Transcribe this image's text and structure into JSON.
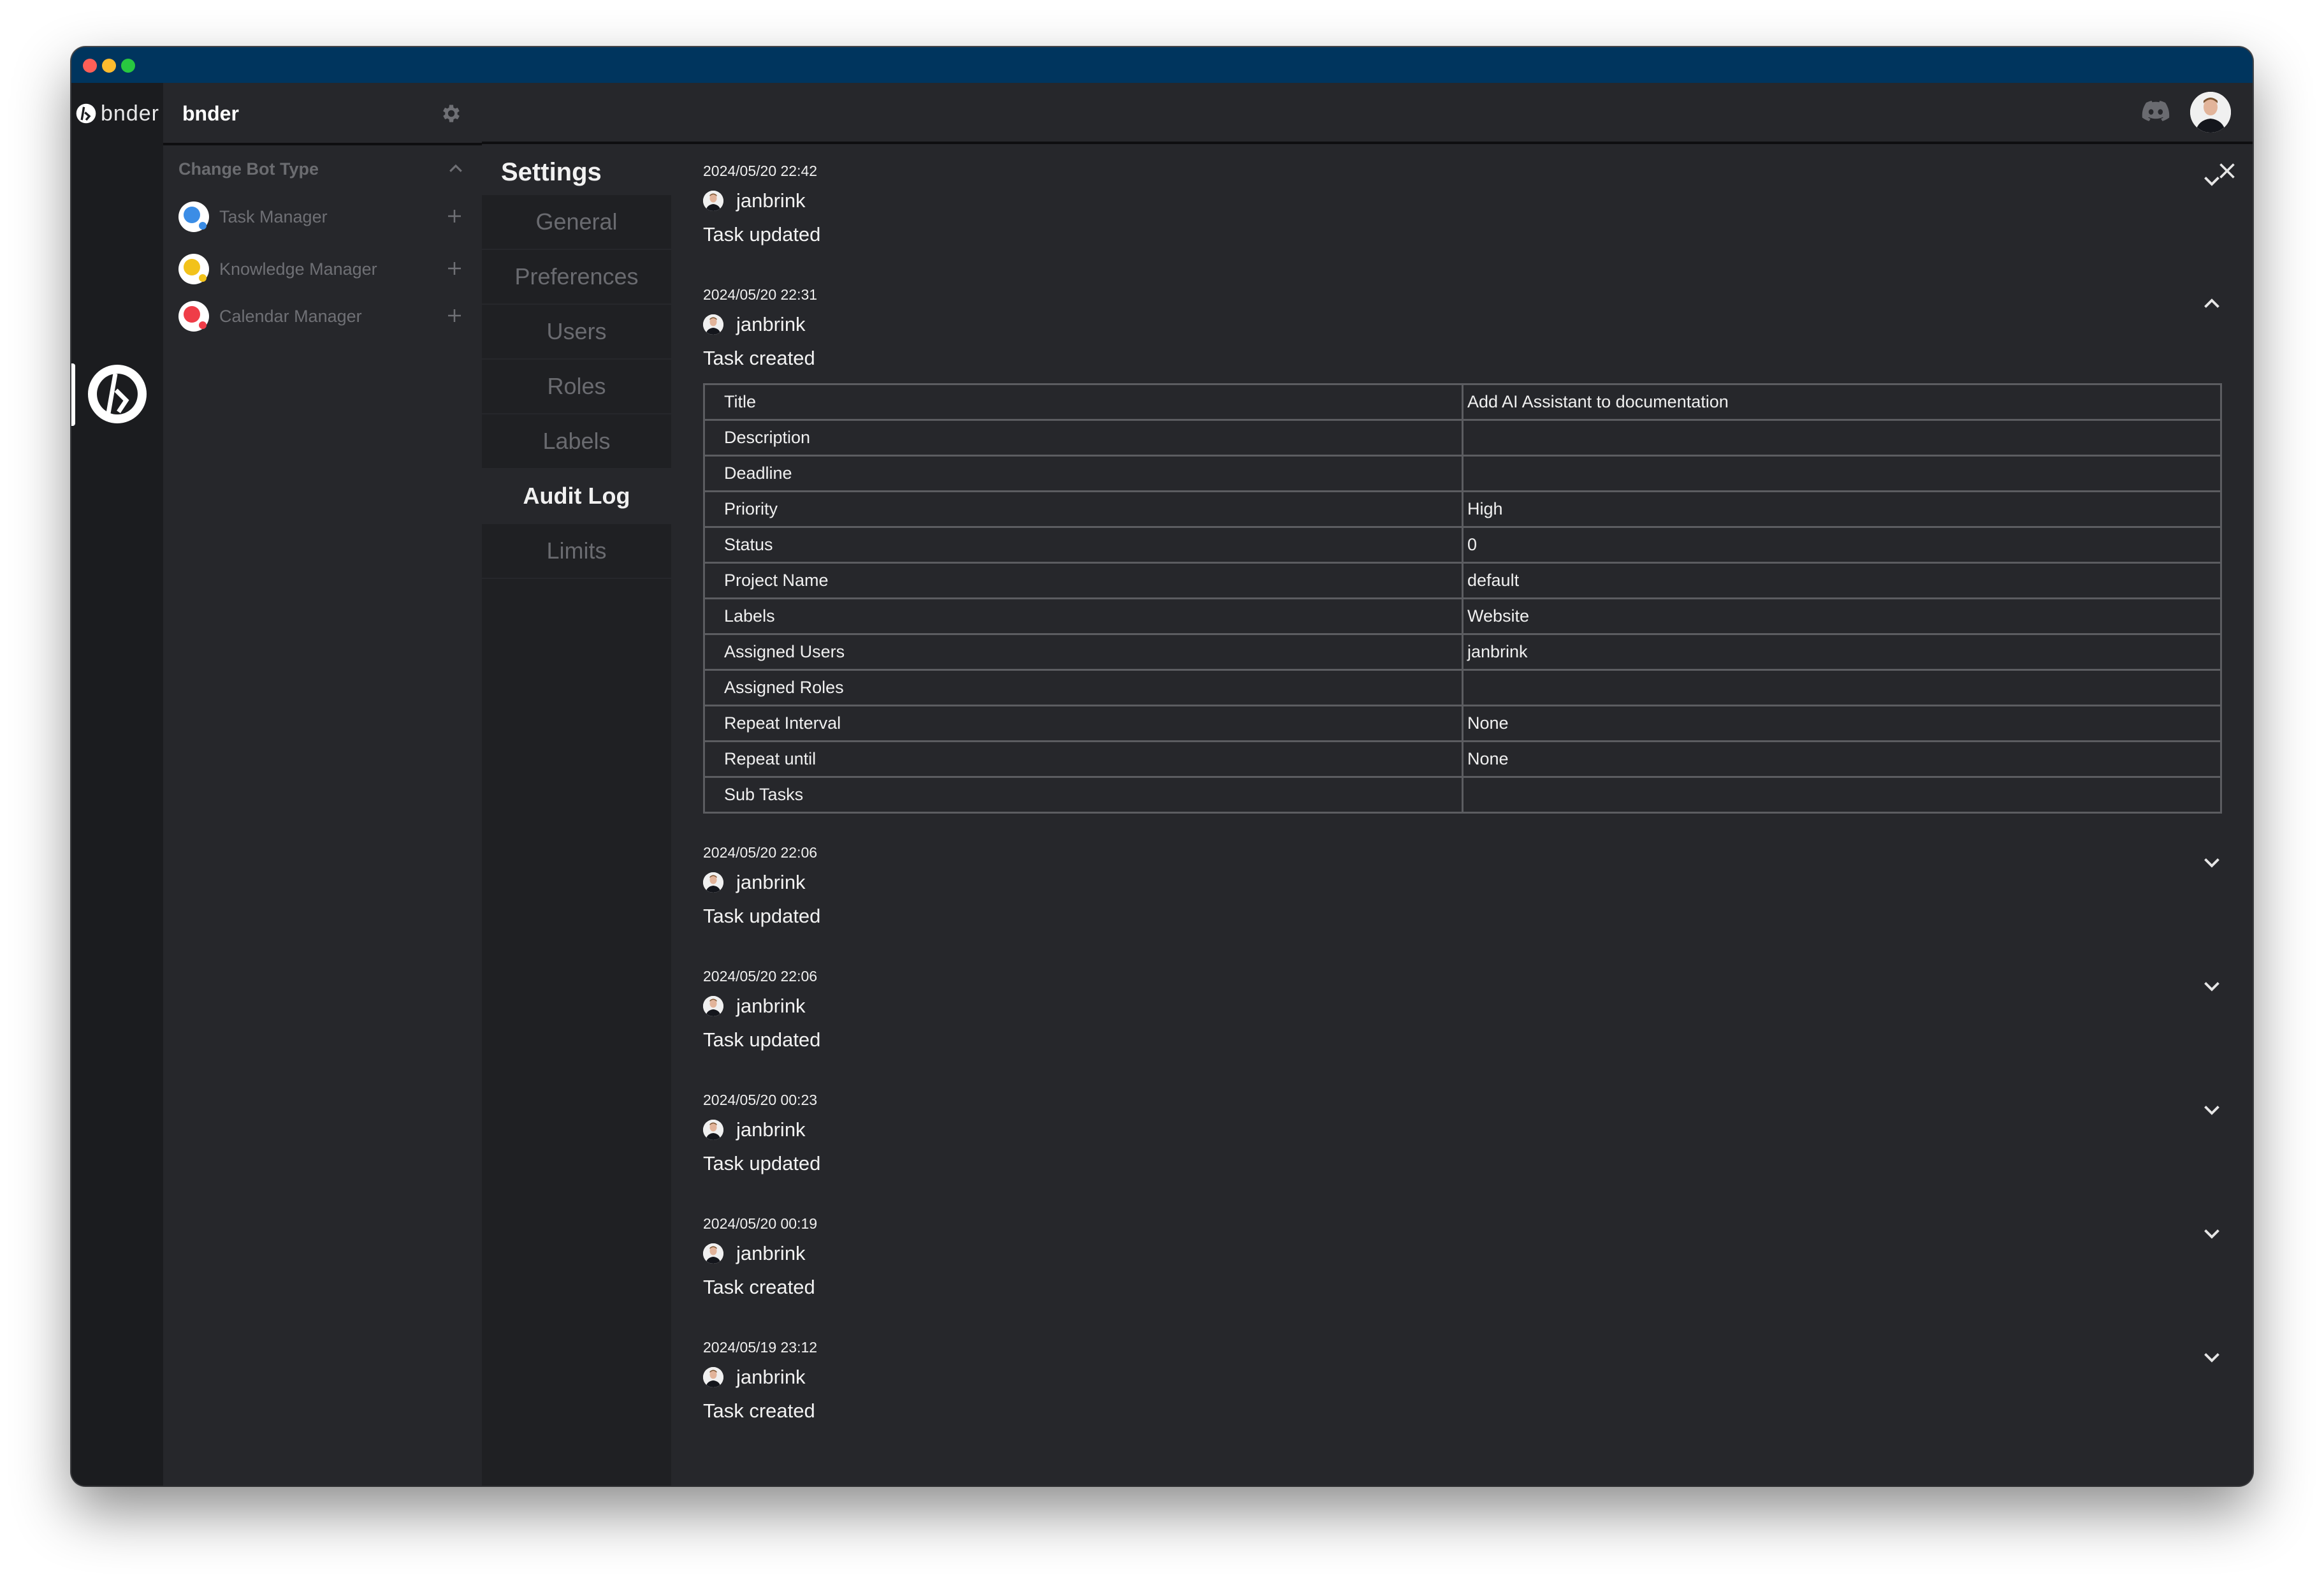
{
  "window": {
    "titlebar_color": "#00355e",
    "traffic_lights": [
      "close",
      "minimize",
      "maximize"
    ]
  },
  "rail": {
    "brand_word": "bnder",
    "active_icon": "bnder-logo-icon"
  },
  "sidebar": {
    "app_name": "bnder",
    "bot_section_title": "Change Bot Type",
    "bots": [
      {
        "label": "Task Manager",
        "color": "#3b8de6"
      },
      {
        "label": "Knowledge Manager",
        "color": "#f2c21b"
      },
      {
        "label": "Calendar Manager",
        "color": "#ef3d48"
      }
    ]
  },
  "header": {
    "discord_icon": "discord-icon",
    "avatar": "user-avatar"
  },
  "settings": {
    "title": "Settings",
    "nav": [
      {
        "label": "General",
        "active": false
      },
      {
        "label": "Preferences",
        "active": false
      },
      {
        "label": "Users",
        "active": false
      },
      {
        "label": "Roles",
        "active": false
      },
      {
        "label": "Labels",
        "active": false
      },
      {
        "label": "Audit Log",
        "active": true
      },
      {
        "label": "Limits",
        "active": false
      }
    ]
  },
  "audit_log": {
    "entries": [
      {
        "time": "2024/05/20 22:42",
        "user": "janbrink",
        "action": "Task updated",
        "expanded": false
      },
      {
        "time": "2024/05/20 22:31",
        "user": "janbrink",
        "action": "Task created",
        "expanded": true,
        "details": [
          {
            "key": "Title",
            "value": "Add AI Assistant to documentation"
          },
          {
            "key": "Description",
            "value": ""
          },
          {
            "key": "Deadline",
            "value": ""
          },
          {
            "key": "Priority",
            "value": "High"
          },
          {
            "key": "Status",
            "value": "0"
          },
          {
            "key": "Project Name",
            "value": "default"
          },
          {
            "key": "Labels",
            "value": "Website"
          },
          {
            "key": "Assigned Users",
            "value": "janbrink"
          },
          {
            "key": "Assigned Roles",
            "value": ""
          },
          {
            "key": "Repeat Interval",
            "value": "None"
          },
          {
            "key": "Repeat until",
            "value": "None"
          },
          {
            "key": "Sub Tasks",
            "value": ""
          }
        ]
      },
      {
        "time": "2024/05/20 22:06",
        "user": "janbrink",
        "action": "Task updated",
        "expanded": false
      },
      {
        "time": "2024/05/20 22:06",
        "user": "janbrink",
        "action": "Task updated",
        "expanded": false
      },
      {
        "time": "2024/05/20 00:23",
        "user": "janbrink",
        "action": "Task updated",
        "expanded": false
      },
      {
        "time": "2024/05/20 00:19",
        "user": "janbrink",
        "action": "Task created",
        "expanded": false
      },
      {
        "time": "2024/05/19 23:12",
        "user": "janbrink",
        "action": "Task created",
        "expanded": false
      }
    ]
  }
}
